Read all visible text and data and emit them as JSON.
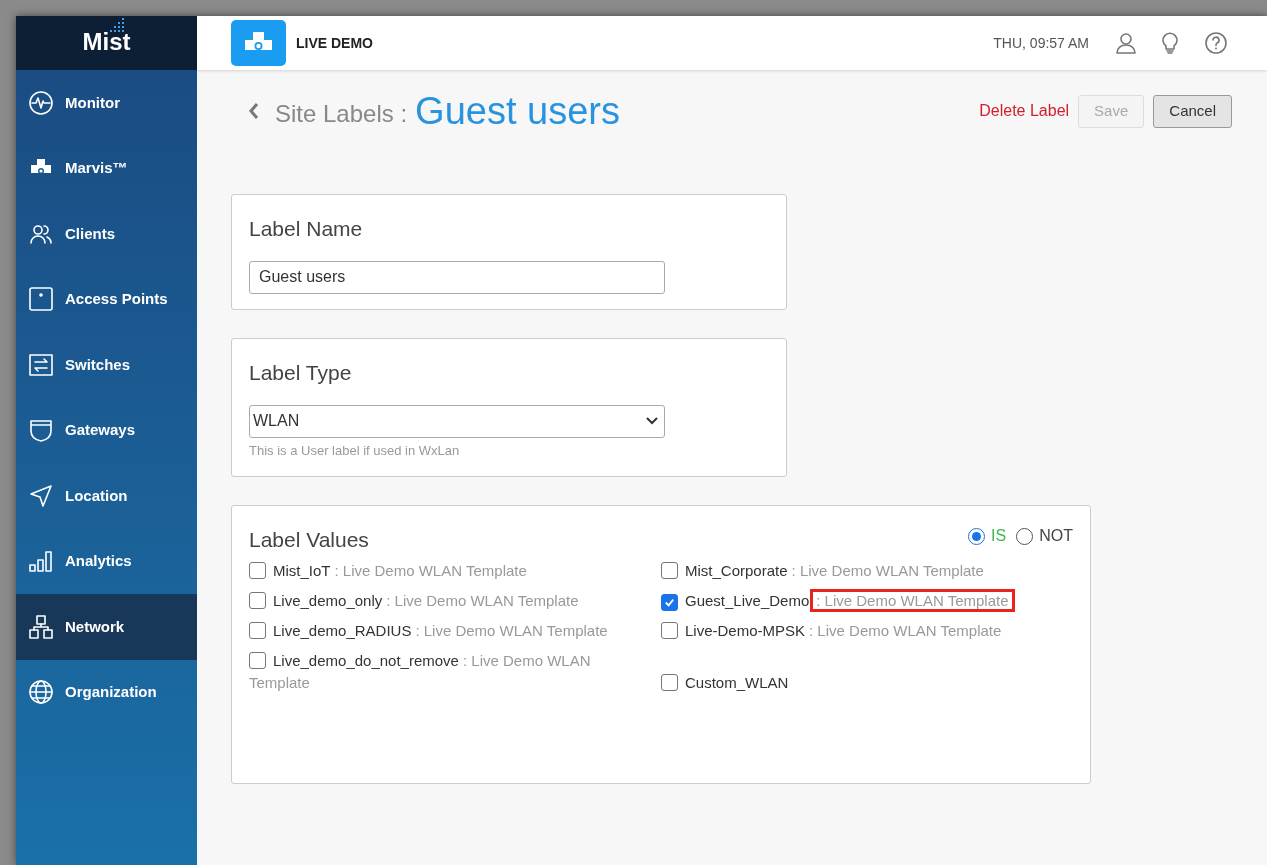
{
  "brand": {
    "logo": "Mist"
  },
  "sidebar": {
    "items": [
      {
        "label": "Monitor",
        "selected": false
      },
      {
        "label": "Marvis™",
        "selected": false
      },
      {
        "label": "Clients",
        "selected": false
      },
      {
        "label": "Access Points",
        "selected": false
      },
      {
        "label": "Switches",
        "selected": false
      },
      {
        "label": "Gateways",
        "selected": false
      },
      {
        "label": "Location",
        "selected": false
      },
      {
        "label": "Analytics",
        "selected": false
      },
      {
        "label": "Network",
        "selected": true
      },
      {
        "label": "Organization",
        "selected": false
      }
    ]
  },
  "header": {
    "site": "LIVE DEMO",
    "datetime": "THU, 09:57 AM"
  },
  "page": {
    "breadcrumb": "Site Labels :",
    "title": "Guest users",
    "delete": "Delete Label",
    "save": {
      "label": "Save",
      "disabled": true
    },
    "cancel": "Cancel"
  },
  "label_name": {
    "heading": "Label Name",
    "value": "Guest users"
  },
  "label_type": {
    "heading": "Label Type",
    "value": "WLAN",
    "hint": "This is a User label if used in WxLan"
  },
  "label_values": {
    "heading": "Label Values",
    "modes": [
      {
        "label": "IS",
        "selected": true
      },
      {
        "label": "NOT",
        "selected": false
      }
    ],
    "values": [
      {
        "name": "Mist_IoT",
        "template": ": Live Demo WLAN Template",
        "checked": false,
        "highlighted": false
      },
      {
        "name": "Mist_Corporate",
        "template": ": Live Demo WLAN Template",
        "checked": false,
        "highlighted": false
      },
      {
        "name": "Live_demo_only",
        "template": ": Live Demo WLAN Template",
        "checked": false,
        "highlighted": false
      },
      {
        "name": "Guest_Live_Demo",
        "template": ": Live Demo WLAN Template",
        "checked": true,
        "highlighted": true
      },
      {
        "name": "Live_demo_RADIUS",
        "template": ": Live Demo WLAN Template",
        "checked": false,
        "highlighted": false
      },
      {
        "name": "Live-Demo-MPSK",
        "template": ": Live Demo WLAN Template",
        "checked": false,
        "highlighted": false
      },
      {
        "name": "Live_demo_do_not_remove",
        "template": ": Live Demo WLAN Template",
        "checked": false,
        "highlighted": false
      },
      {
        "name": "Custom_WLAN",
        "checked": false,
        "highlighted": false
      }
    ]
  }
}
